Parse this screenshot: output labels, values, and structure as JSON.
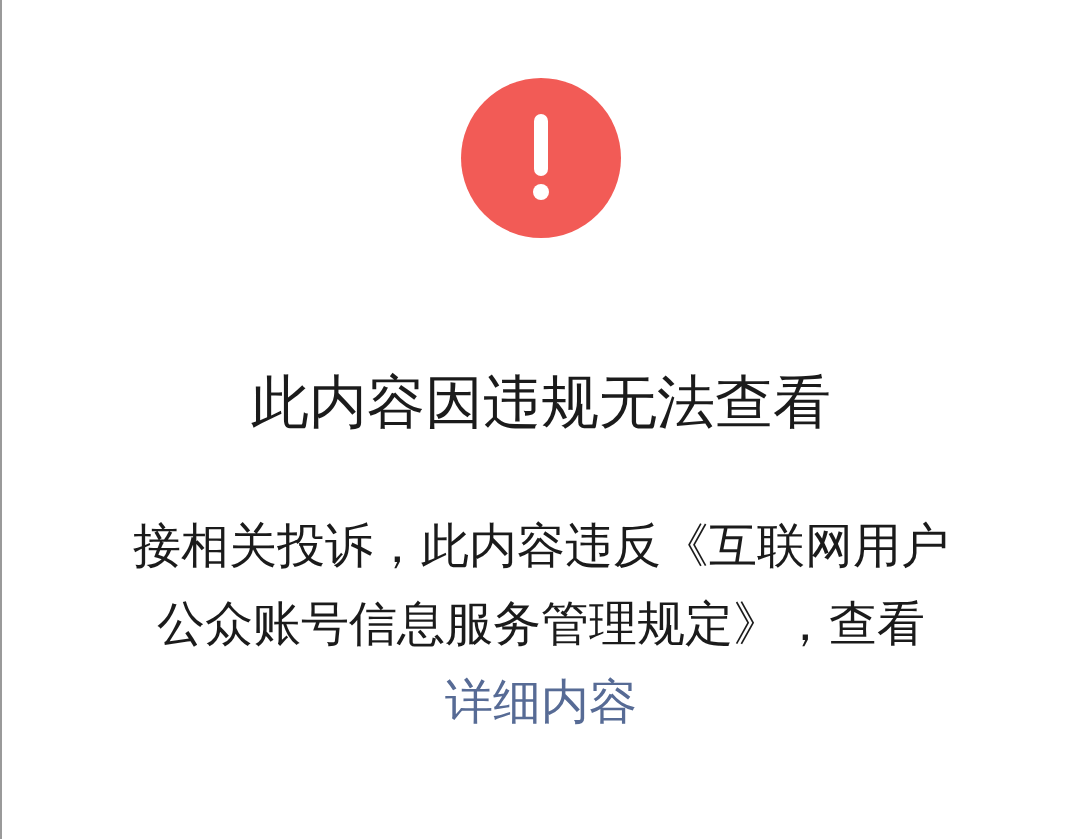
{
  "notice": {
    "title": "此内容因违规无法查看",
    "message": "接相关投诉，此内容违反《互联网用户公众账号信息服务管理规定》，查看",
    "link": "详细内容"
  }
}
